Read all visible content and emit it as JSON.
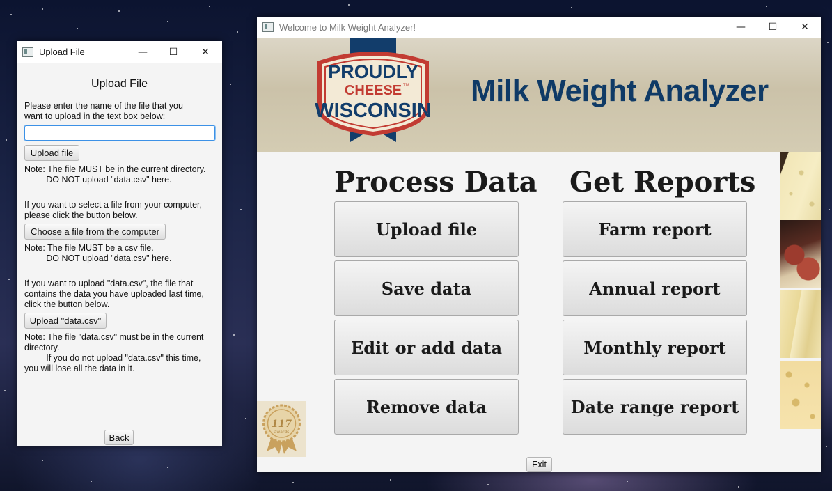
{
  "upload_window": {
    "title": "Upload File",
    "heading": "Upload File",
    "instruction": "Please enter the name of the file that you\nwant to upload in the text box below:",
    "filename_input": {
      "value": "",
      "placeholder": ""
    },
    "upload_button": "Upload file",
    "note1": "Note: The file MUST be in the current directory.\n         DO NOT upload \"data.csv\" here.",
    "choose_instruction": "If you want to select a file from your computer,\nplease click the button below.",
    "choose_button": "Choose a file from the computer",
    "note2": "Note: The file MUST be a csv file.\n         DO NOT upload \"data.csv\" here.",
    "datacsv_instruction": "If you want to upload \"data.csv\", the file that\ncontains the data you have uploaded last time,\nclick the button below.",
    "datacsv_button": "Upload \"data.csv\"",
    "note3": "Note: The file \"data.csv\" must be in the current\ndirectory.\n         If you do not upload \"data.csv\" this time,\nyou will lose all the data in it.",
    "back_button": "Back"
  },
  "main_window": {
    "title": "Welcome to Milk Weight Analyzer!",
    "banner": {
      "title": "Milk Weight Analyzer",
      "logo": {
        "line1": "PROUDLY",
        "line2": "CHEESE",
        "line3": "WISCONSIN",
        "tm": "TM"
      }
    },
    "process_section": {
      "heading": "Process Data",
      "buttons": [
        "Upload file",
        "Save data",
        "Edit or add data",
        "Remove data"
      ]
    },
    "reports_section": {
      "heading": "Get Reports",
      "buttons": [
        "Farm report",
        "Annual report",
        "Monthly report",
        "Date range report"
      ]
    },
    "badge": {
      "number": "117",
      "caption": "awards"
    },
    "exit_button": "Exit"
  },
  "window_controls": {
    "minimize": "—",
    "maximize": "☐",
    "close": "✕"
  }
}
